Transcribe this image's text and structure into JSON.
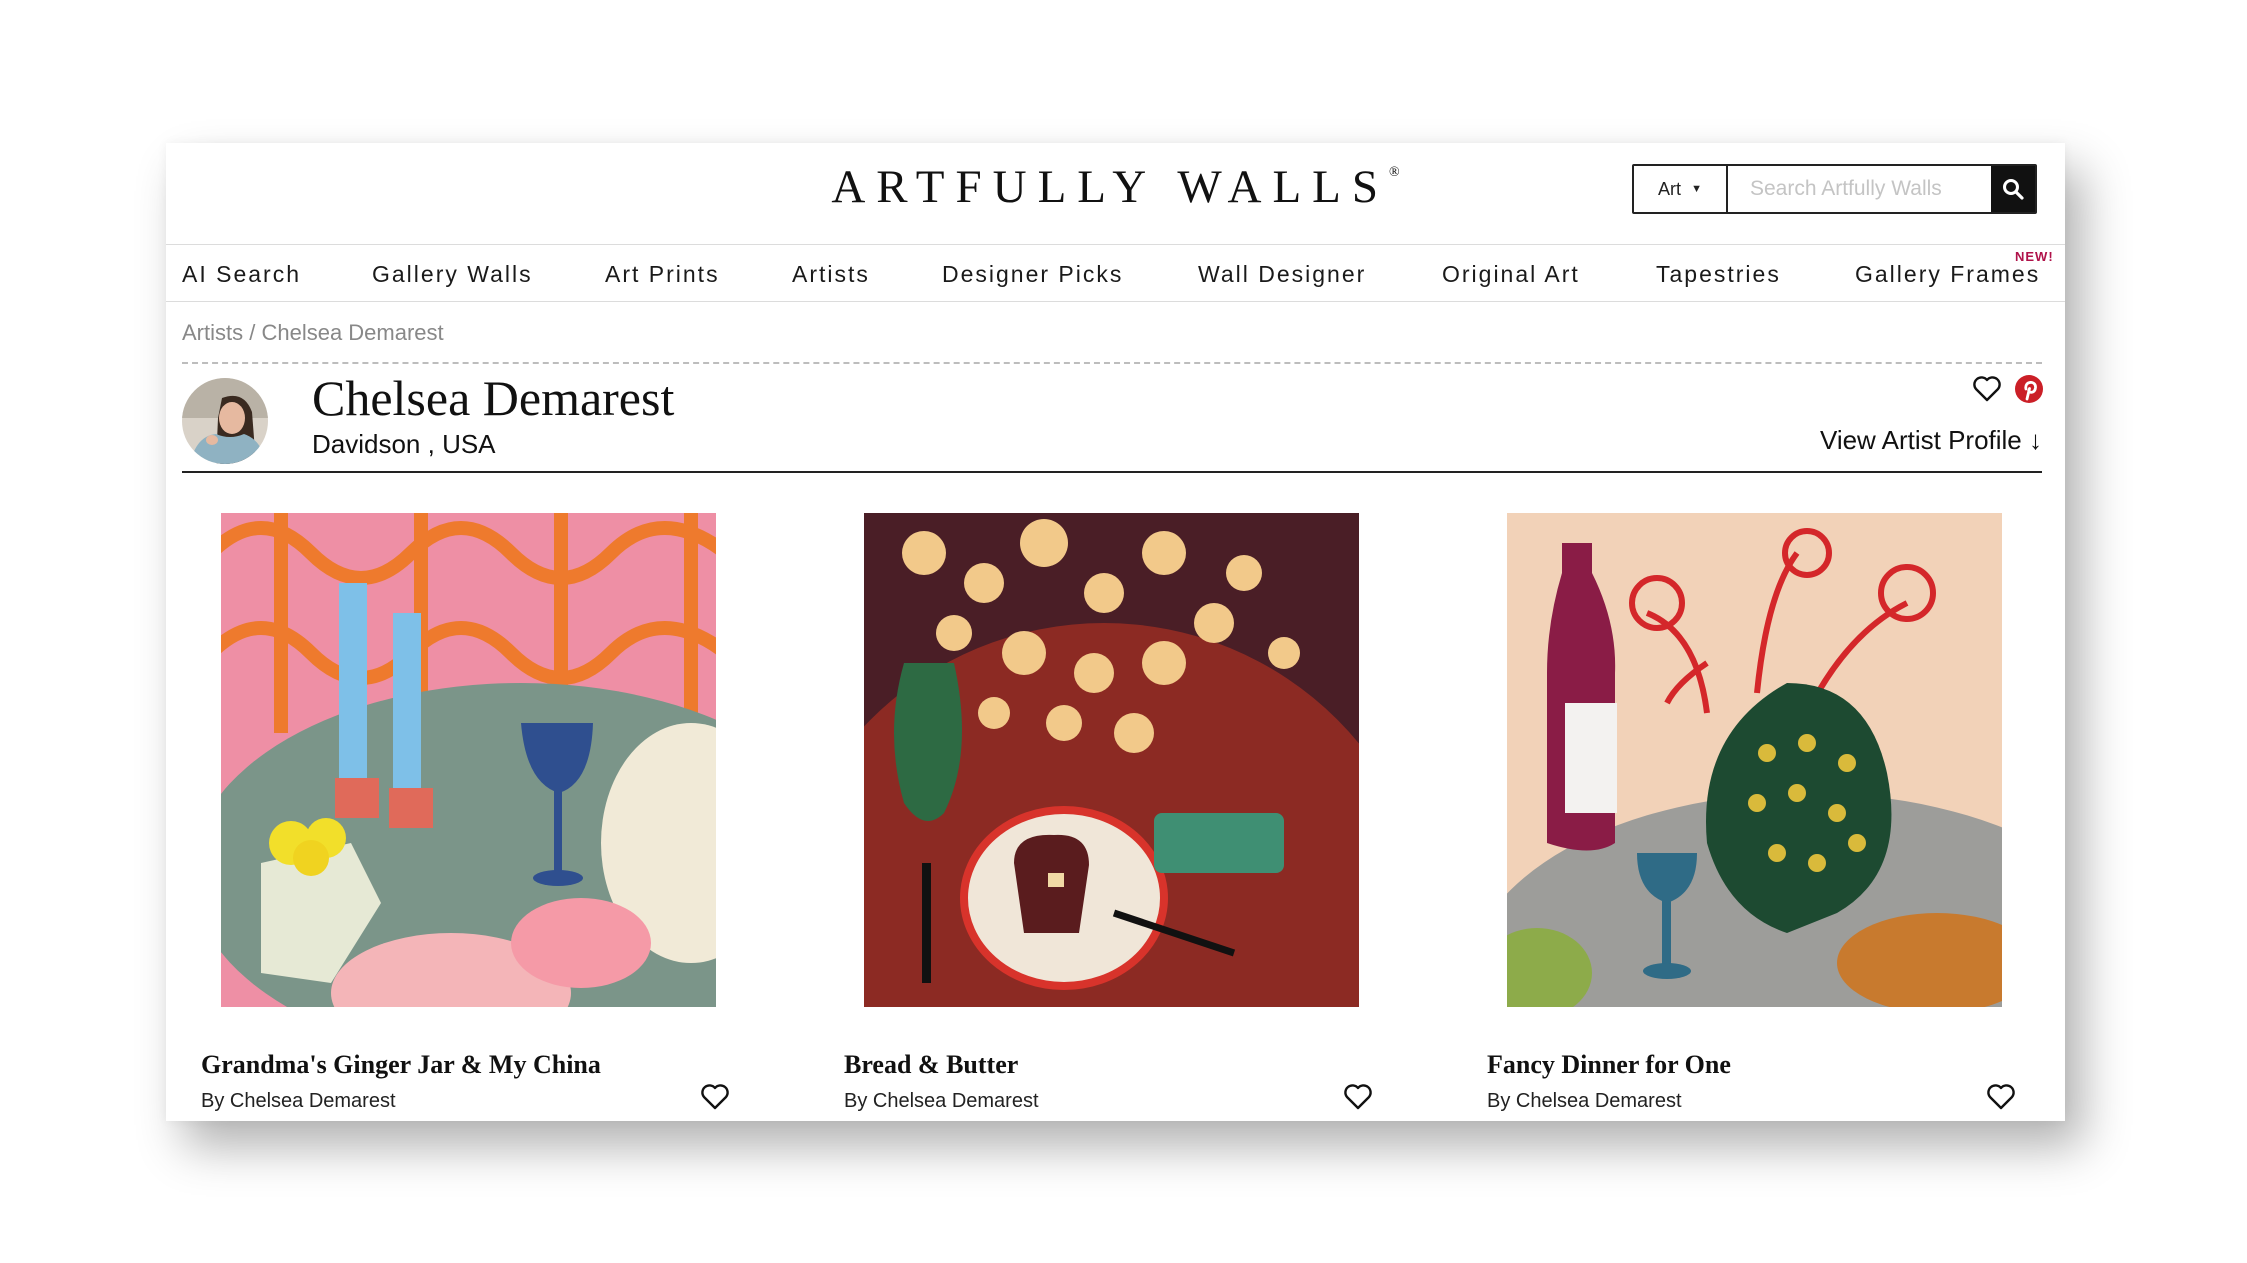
{
  "header": {
    "logo_text": "ARTFULLY WALLS",
    "logo_mark": "®",
    "search": {
      "category": "Art",
      "placeholder": "Search Artfully Walls",
      "button_icon": "search-icon"
    }
  },
  "nav": {
    "items": [
      {
        "label": "AI Search"
      },
      {
        "label": "Gallery Walls"
      },
      {
        "label": "Art Prints"
      },
      {
        "label": "Artists"
      },
      {
        "label": "Designer Picks"
      },
      {
        "label": "Wall Designer"
      },
      {
        "label": "Original Art"
      },
      {
        "label": "Tapestries"
      },
      {
        "label": "Gallery Frames"
      }
    ],
    "new_badge": "NEW!"
  },
  "breadcrumb": {
    "root": "Artists",
    "separator": " / ",
    "current": "Chelsea Demarest"
  },
  "artist": {
    "name": "Chelsea Demarest",
    "location": "Davidson , USA",
    "view_profile": "View Artist Profile ↓",
    "icons": [
      "heart-icon",
      "pinterest-icon"
    ]
  },
  "artworks": [
    {
      "title": "Grandma's Ginger Jar & My China",
      "by": "By Chelsea Demarest"
    },
    {
      "title": "Bread & Butter",
      "by": "By Chelsea Demarest"
    },
    {
      "title": "Fancy Dinner for One",
      "by": "By Chelsea Demarest"
    }
  ],
  "colors": {
    "accent_pinterest": "#cb1f27",
    "badge": "#b0124a",
    "text": "#111111",
    "breadcrumb": "#888888"
  }
}
